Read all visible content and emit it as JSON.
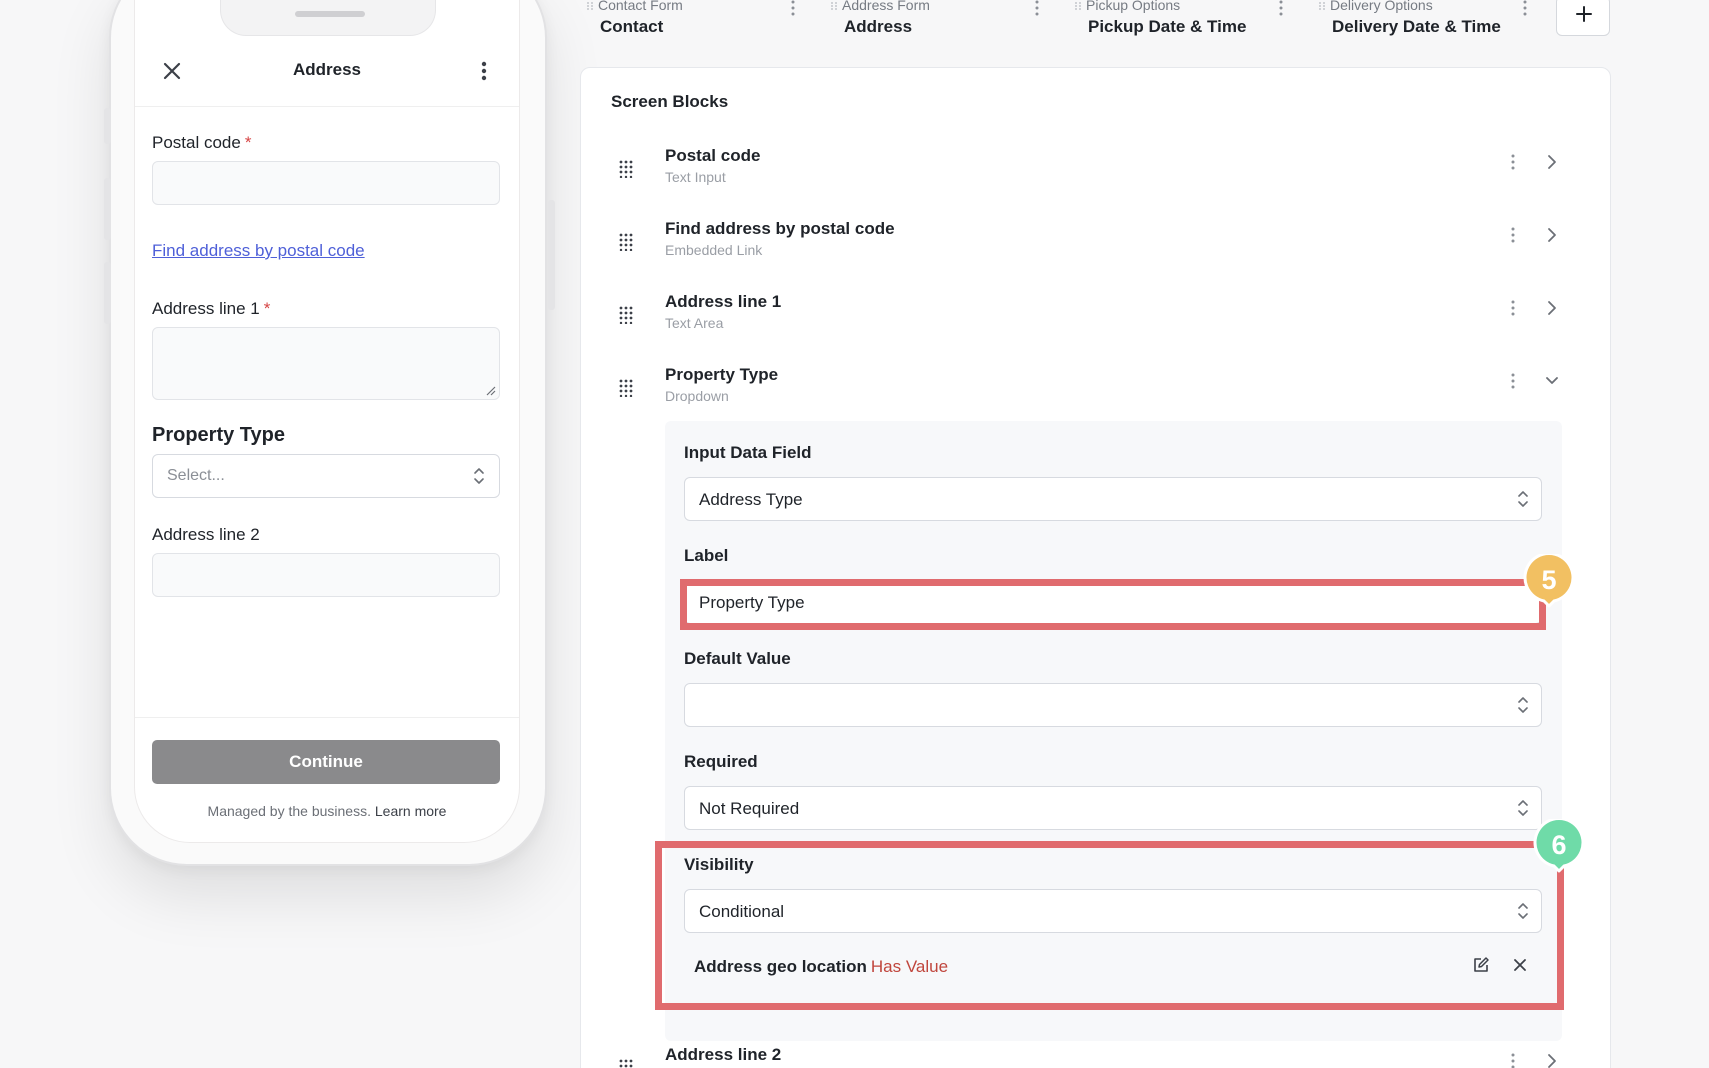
{
  "phone": {
    "header": {
      "title": "Address"
    },
    "fields": {
      "postal_code_label": "Postal code",
      "find_address_link": "Find address by postal code",
      "address_line1_label": "Address line 1",
      "property_type_label": "Property Type",
      "property_type_placeholder": "Select...",
      "address_line2_label": "Address line 2",
      "required_mark": "*"
    },
    "footer": {
      "continue_label": "Continue",
      "managed_text": "Managed by the business.",
      "learn_more": "Learn more"
    }
  },
  "steps": [
    {
      "caption": "Contact Form",
      "name": "Contact"
    },
    {
      "caption": "Address Form",
      "name": "Address"
    },
    {
      "caption": "Pickup Options",
      "name": "Pickup Date & Time"
    },
    {
      "caption": "Delivery Options",
      "name": "Delivery Date & Time"
    }
  ],
  "screen_blocks": {
    "title": "Screen Blocks",
    "blocks": [
      {
        "title": "Postal code",
        "type": "Text Input"
      },
      {
        "title": "Find address by postal code",
        "type": "Embedded Link"
      },
      {
        "title": "Address line 1",
        "type": "Text Area"
      },
      {
        "title": "Property Type",
        "type": "Dropdown"
      },
      {
        "title": "Address line 2",
        "type": ""
      }
    ],
    "expanded": {
      "input_data_field_label": "Input Data Field",
      "input_data_field_value": "Address Type",
      "label_label": "Label",
      "label_value": "Property Type",
      "default_value_label": "Default Value",
      "default_value_value": "",
      "required_label": "Required",
      "required_value": "Not Required",
      "visibility_label": "Visibility",
      "visibility_value": "Conditional",
      "condition": {
        "field": "Address geo location",
        "operator": "Has Value"
      }
    }
  },
  "annotations": [
    {
      "number": "5",
      "color": "#f2c062"
    },
    {
      "number": "6",
      "color": "#6fdba8"
    }
  ],
  "colors": {
    "highlight": "#e06b6e",
    "link": "#4e5fd8",
    "required": "#d64545",
    "condition_operator": "#c0463d"
  }
}
